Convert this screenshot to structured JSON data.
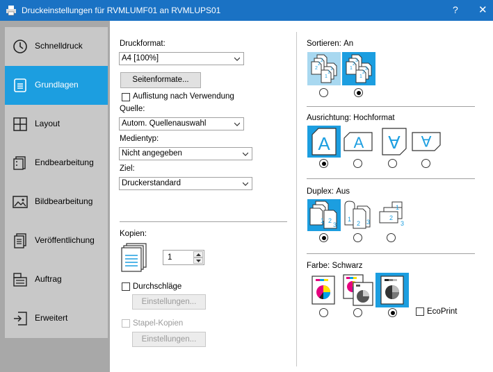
{
  "window": {
    "title": "Druckeinstellungen für RVMLUMF01 an RVMLUPS01",
    "help": "?",
    "close": "✕"
  },
  "sidebar": {
    "items": [
      {
        "label": "Schnelldruck",
        "icon": "clock-icon",
        "active": false
      },
      {
        "label": "Grundlagen",
        "icon": "document-icon",
        "active": true
      },
      {
        "label": "Layout",
        "icon": "layout-grid-icon",
        "active": false
      },
      {
        "label": "Endbearbeitung",
        "icon": "finishing-icon",
        "active": false
      },
      {
        "label": "Bildbearbeitung",
        "icon": "image-icon",
        "active": false
      },
      {
        "label": "Veröffentlichung",
        "icon": "publishing-icon",
        "active": false
      },
      {
        "label": "Auftrag",
        "icon": "job-icon",
        "active": false
      },
      {
        "label": "Erweitert",
        "icon": "advanced-icon",
        "active": false
      }
    ]
  },
  "paper": {
    "format_label": "Druckformat:",
    "format_value": "A4  [100%]",
    "page_formats_button": "Seitenformate...",
    "list_after_use_label": "Auflistung nach Verwendung",
    "list_after_use_checked": false,
    "source_label": "Quelle:",
    "source_value": "Autom. Quellenauswahl",
    "media_label": "Medientyp:",
    "media_value": "Nicht angegeben",
    "target_label": "Ziel:",
    "target_value": "Druckerstandard"
  },
  "copies": {
    "label": "Kopien:",
    "value": "1",
    "carbon_label": "Durchschläge",
    "carbon_checked": false,
    "carbon_settings": "Einstellungen...",
    "stack_label": "Stapel-Kopien",
    "stack_checked": false,
    "stack_settings": "Einstellungen..."
  },
  "sort": {
    "label": "Sortieren:",
    "value": "An",
    "selected": 1
  },
  "orientation": {
    "label": "Ausrichtung:",
    "value": "Hochformat",
    "selected": 0
  },
  "duplex": {
    "label": "Duplex:",
    "value": "Aus",
    "selected": 0
  },
  "color": {
    "label": "Farbe:",
    "value": "Schwarz",
    "selected": 2,
    "ecoprint_label": "EcoPrint",
    "ecoprint_checked": false
  },
  "colors": {
    "titlebar": "#1a72c4",
    "accent": "#1c9ee0",
    "sidebar_bg": "#a8a8a8",
    "sidebar_item": "#c8c8c8"
  }
}
